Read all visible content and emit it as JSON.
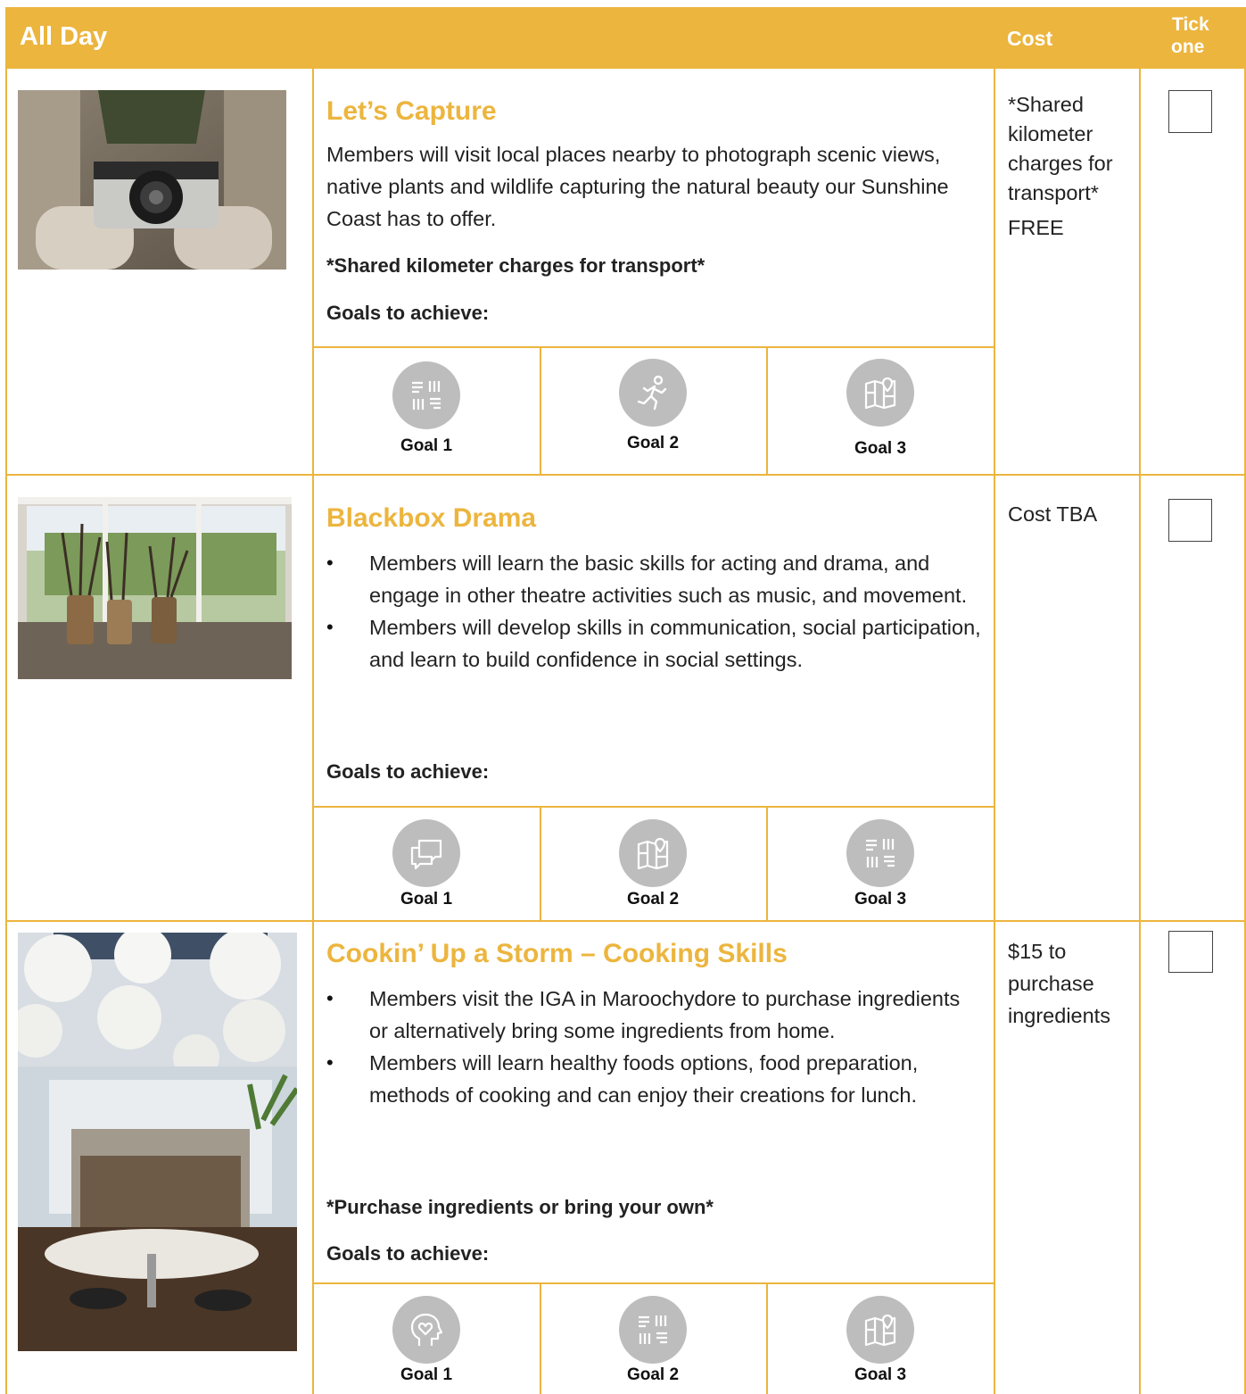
{
  "header": {
    "section_title": "All Day",
    "cost_label": "Cost",
    "tick_label_1": "Tick",
    "tick_label_2": "one"
  },
  "goals_label": "Goals to achieve:",
  "activities": [
    {
      "title": "Let’s Capture",
      "description": "Members will visit local places nearby to photograph scenic views, native plants and wildlife capturing the natural beauty our Sunshine Coast has to offer.",
      "note": "*Shared kilometer charges for transport*",
      "cost_lines": [
        "*Shared",
        "kilometer",
        "charges for",
        "transport*",
        "FREE"
      ],
      "goals": [
        {
          "label": "Goal 1",
          "icon": "hands-icon"
        },
        {
          "label": "Goal 2",
          "icon": "running-person-icon"
        },
        {
          "label": "Goal 3",
          "icon": "map-pin-icon"
        }
      ]
    },
    {
      "title": "Blackbox Drama",
      "bullets": [
        "Members will learn the basic skills for acting and drama, and engage in other theatre activities such as music, and movement.",
        "Members will develop skills in communication, social participation, and learn to build confidence in social settings."
      ],
      "cost_lines": [
        "Cost TBA"
      ],
      "goals": [
        {
          "label": "Goal 1",
          "icon": "chat-bubbles-icon"
        },
        {
          "label": "Goal 2",
          "icon": "map-pin-icon"
        },
        {
          "label": "Goal 3",
          "icon": "hands-icon"
        }
      ]
    },
    {
      "title": "Cookin’ Up a Storm – Cooking Skills",
      "bullets": [
        "Members visit the IGA in Maroochydore to purchase ingredients or alternatively bring some ingredients from home.",
        "Members will learn healthy foods options, food preparation, methods of cooking and can enjoy their creations for lunch."
      ],
      "note": "*Purchase ingredients or bring your own*",
      "cost_lines": [
        "$15 to",
        "purchase",
        "ingredients"
      ],
      "goals": [
        {
          "label": "Goal 1",
          "icon": "head-heart-icon"
        },
        {
          "label": "Goal 2",
          "icon": "hands-icon"
        },
        {
          "label": "Goal 3",
          "icon": "map-pin-icon"
        }
      ]
    }
  ],
  "colors": {
    "accent": "#ecb53e",
    "icon_grey": "#bdbdbd",
    "text": "#222222"
  }
}
